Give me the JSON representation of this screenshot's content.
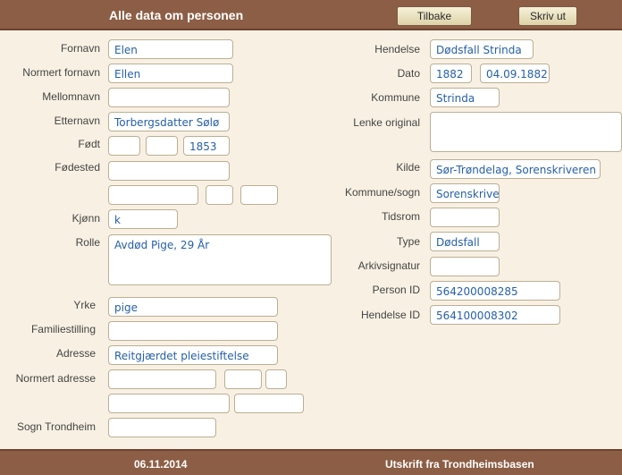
{
  "header": {
    "title": "Alle data om personen",
    "back_label": "Tilbake",
    "print_label": "Skriv ut"
  },
  "left": {
    "fornavn_label": "Fornavn",
    "fornavn_value": "Elen",
    "normert_fornavn_label": "Normert fornavn",
    "normert_fornavn_value": "Ellen",
    "mellomnavn_label": "Mellomnavn",
    "mellomnavn_value": "",
    "etternavn_label": "Etternavn",
    "etternavn_value": "Torbergsdatter Sølø",
    "fodt_label": "Født",
    "fodt_day": "",
    "fodt_month": "",
    "fodt_year": "1853",
    "fodested_label": "Fødested",
    "fodested_value": "",
    "kjonn_label": "Kjønn",
    "kjonn_value": "k",
    "rolle_label": "Rolle",
    "rolle_value": "Avdød Pige, 29 År",
    "yrke_label": "Yrke",
    "yrke_value": "pige",
    "familiestilling_label": "Familiestilling",
    "familiestilling_value": "",
    "adresse_label": "Adresse",
    "adresse_value": "Reitgjærdet pleiestiftelse",
    "normert_adresse_label": "Normert adresse",
    "sogn_label": "Sogn Trondheim",
    "sogn_value": ""
  },
  "right": {
    "hendelse_label": "Hendelse",
    "hendelse_value": "Dødsfall Strinda",
    "dato_label": "Dato",
    "dato_year": "1882",
    "dato_value": "04.09.1882",
    "kommune_label": "Kommune",
    "kommune_value": "Strinda",
    "lenke_label": "Lenke original",
    "lenke_value": "",
    "kilde_label": "Kilde",
    "kilde_value": "Sør-Trøndelag, Sorenskriveren",
    "kommune_sogn_label": "Kommune/sogn",
    "kommune_sogn_value": "Sorenskrive",
    "tidsrom_label": "Tidsrom",
    "tidsrom_value": "",
    "type_label": "Type",
    "type_value": "Dødsfall",
    "arkivsignatur_label": "Arkivsignatur",
    "arkivsignatur_value": "",
    "person_id_label": "Person ID",
    "person_id_value": "564200008285",
    "hendelse_id_label": "Hendelse ID",
    "hendelse_id_value": "564100008302"
  },
  "footer": {
    "date": "06.11.2014",
    "source": "Utskrift fra Trondheimsbasen"
  }
}
